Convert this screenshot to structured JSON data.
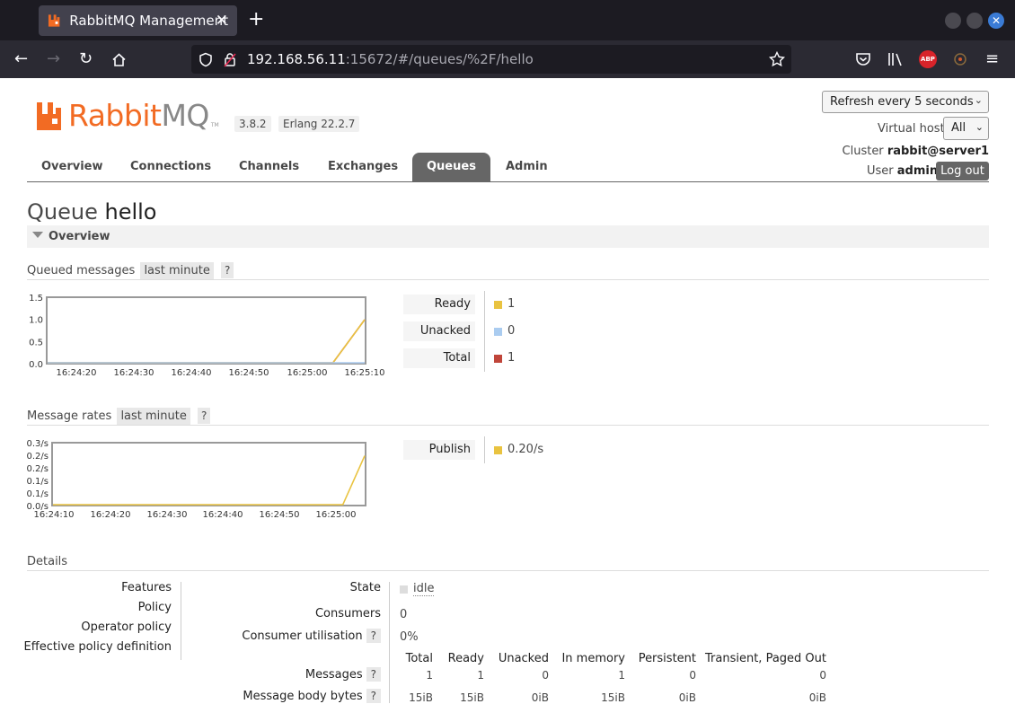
{
  "browser": {
    "tab_title": "RabbitMQ Management",
    "url_host": "192.168.56.11",
    "url_rest": ":15672/#/queues/%2F/hello",
    "abp_label": "ABP"
  },
  "header": {
    "logo_rabbit": "Rabbit",
    "logo_mq": "MQ",
    "logo_tm": "TM",
    "version": "3.8.2",
    "erlang": "Erlang 22.2.7",
    "refresh": "Refresh every 5 seconds",
    "vhost_label": "Virtual host",
    "vhost_value": "All",
    "cluster_label": "Cluster",
    "cluster_value": "rabbit@server1",
    "user_label": "User",
    "user_value": "admin",
    "logout": "Log out"
  },
  "nav": [
    "Overview",
    "Connections",
    "Channels",
    "Exchanges",
    "Queues",
    "Admin"
  ],
  "title": {
    "prefix": "Queue",
    "name": "hello"
  },
  "overview_label": "Overview",
  "queued": {
    "heading": "Queued messages",
    "range": "last minute",
    "help": "?",
    "legend": [
      {
        "label": "Ready",
        "value": "1",
        "color": "#e9c340"
      },
      {
        "label": "Unacked",
        "value": "0",
        "color": "#aaccf0"
      },
      {
        "label": "Total",
        "value": "1",
        "color": "#c0453a"
      }
    ]
  },
  "rates": {
    "heading": "Message rates",
    "range": "last minute",
    "help": "?",
    "legend": [
      {
        "label": "Publish",
        "value": "0.20/s",
        "color": "#e9c340"
      }
    ]
  },
  "chart_data": [
    {
      "type": "line",
      "title": "Queued messages",
      "x": [
        "16:24:20",
        "16:24:30",
        "16:24:40",
        "16:24:50",
        "16:25:00",
        "16:25:10"
      ],
      "y_ticks": [
        "1.5",
        "1.0",
        "0.5",
        "0.0"
      ],
      "ylim": [
        0,
        1.5
      ],
      "series": [
        {
          "name": "Total",
          "color": "#c0453a",
          "points": [
            [
              0,
              0
            ],
            [
              0.9,
              0
            ],
            [
              1,
              1
            ]
          ]
        },
        {
          "name": "Ready",
          "color": "#e9c340",
          "points": [
            [
              0,
              0
            ],
            [
              0.9,
              0
            ],
            [
              1,
              1
            ]
          ]
        },
        {
          "name": "Unacked",
          "color": "#aaccf0",
          "points": [
            [
              0,
              0
            ],
            [
              1,
              0
            ]
          ]
        }
      ]
    },
    {
      "type": "line",
      "title": "Message rates",
      "x": [
        "16:24:10",
        "16:24:20",
        "16:24:30",
        "16:24:40",
        "16:24:50",
        "16:25:00"
      ],
      "y_ticks": [
        "0.3/s",
        "0.2/s",
        "0.2/s",
        "0.1/s",
        "0.1/s",
        "0.0/s"
      ],
      "ylim": [
        0,
        0.25
      ],
      "series": [
        {
          "name": "Publish",
          "color": "#e9c340",
          "points": [
            [
              0,
              0
            ],
            [
              0.93,
              0
            ],
            [
              1,
              0.2
            ]
          ]
        }
      ]
    }
  ],
  "details": {
    "heading": "Details",
    "left_labels": [
      "Features",
      "Policy",
      "Operator policy",
      "Effective policy definition"
    ],
    "state_label": "State",
    "state_value": "idle",
    "consumers_label": "Consumers",
    "consumers_value": "0",
    "util_label": "Consumer utilisation",
    "util_value": "0%",
    "help": "?",
    "columns": [
      "Total",
      "Ready",
      "Unacked",
      "In memory",
      "Persistent",
      "Transient, Paged Out"
    ],
    "rows": [
      {
        "label": "Messages",
        "values": [
          "1",
          "1",
          "0",
          "1",
          "0",
          "0"
        ]
      },
      {
        "label": "Message body bytes",
        "values": [
          "15iB",
          "15iB",
          "0iB",
          "15iB",
          "0iB",
          "0iB"
        ]
      }
    ]
  }
}
